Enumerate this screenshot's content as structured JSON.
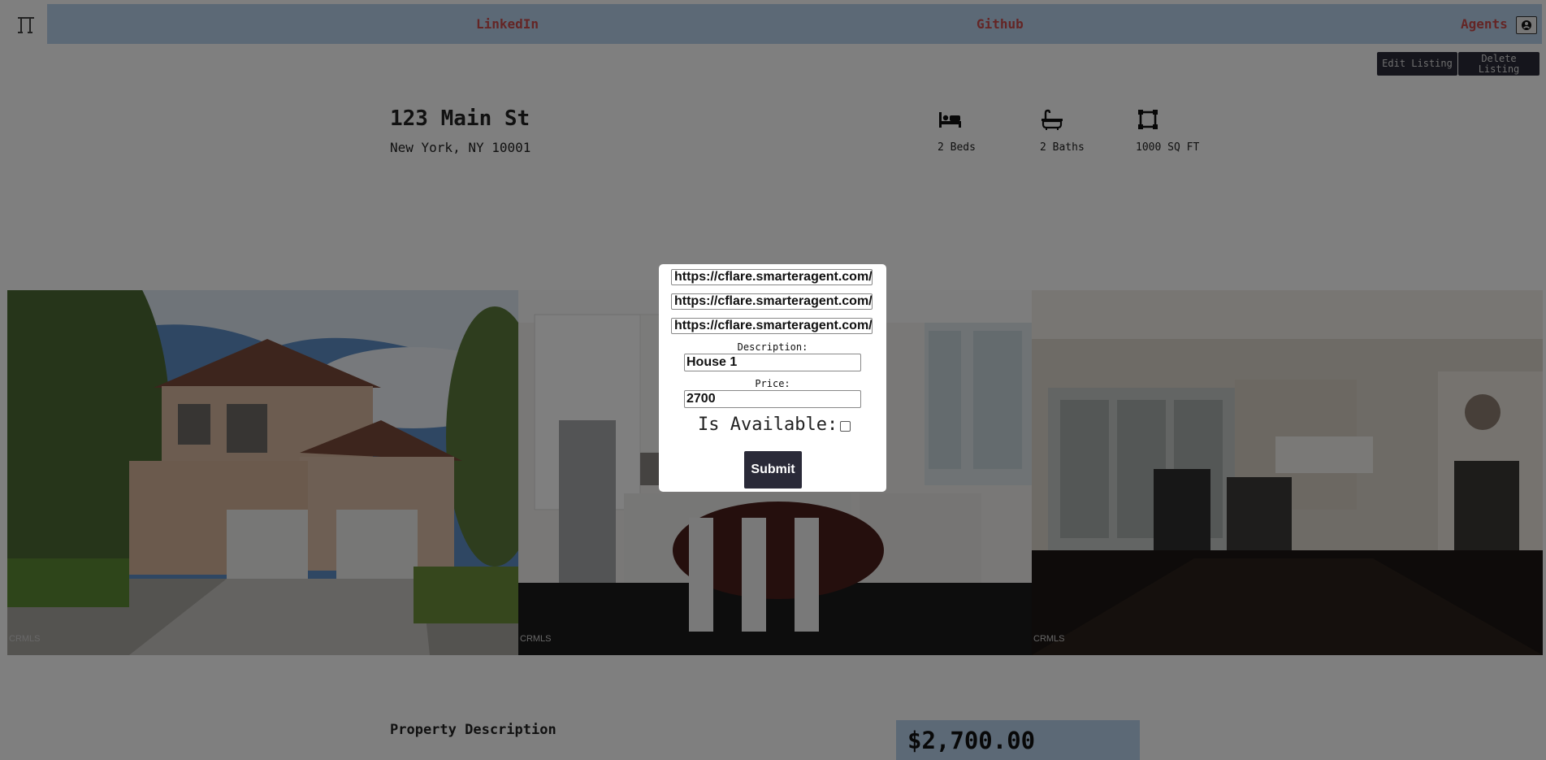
{
  "nav": {
    "logo_icon": "door-frame-icon",
    "links": [
      "LinkedIn",
      "Github",
      "Agents"
    ],
    "user_icon": "user-circle-icon",
    "link_color": "#c94a4a",
    "bar_color": "#b9d3ec"
  },
  "actions": {
    "edit_label": "Edit Listing",
    "delete_label": "Delete Listing"
  },
  "property": {
    "address": "123 Main St",
    "city_line": "New York, NY 10001",
    "stats": [
      {
        "icon": "bed-icon",
        "label": "2 Beds"
      },
      {
        "icon": "bathtub-icon",
        "label": "2 Baths"
      },
      {
        "icon": "square-footage-icon",
        "label": "1000 SQ FT"
      }
    ]
  },
  "gallery": {
    "photos": [
      {
        "subject": "house exterior",
        "credit": "CRMLS"
      },
      {
        "subject": "kitchen",
        "credit": "CRMLS"
      },
      {
        "subject": "living room",
        "credit": "CRMLS"
      }
    ]
  },
  "details": {
    "section_title": "Property Description",
    "price": "$2,700.00"
  },
  "modal": {
    "image_urls": [
      "https://cflare.smarteragent.com/",
      "https://cflare.smarteragent.com/",
      "https://cflare.smarteragent.com/"
    ],
    "description_label": "Description:",
    "description_value": "House 1",
    "price_label": "Price:",
    "price_value": "2700",
    "available_label": "Is Available:",
    "available_checked": false,
    "submit_label": "Submit"
  }
}
